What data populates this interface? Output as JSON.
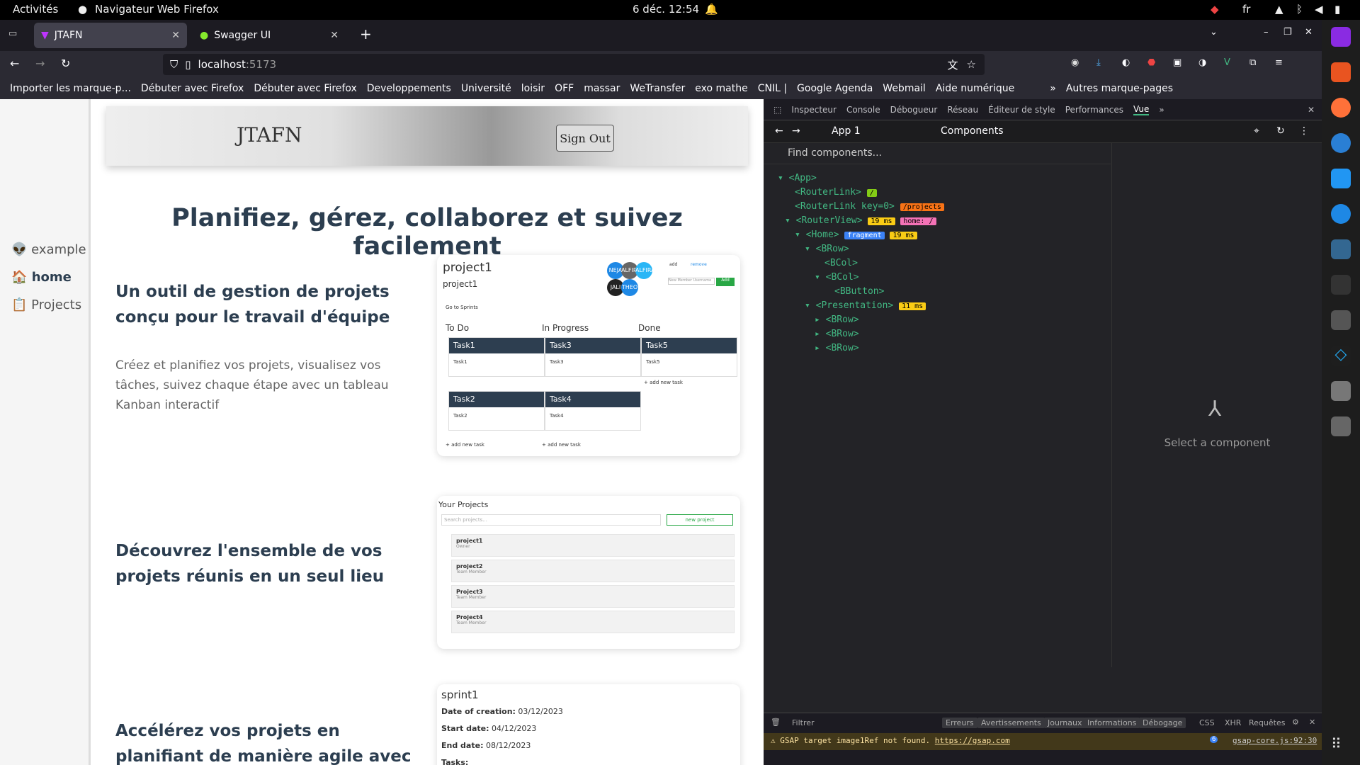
{
  "system": {
    "activities": "Activités",
    "app": "Navigateur Web Firefox",
    "clock": "6 déc. 12:54",
    "lang": "fr"
  },
  "tabs": [
    {
      "title": "JTAFN"
    },
    {
      "title": "Swagger UI"
    }
  ],
  "url": {
    "host": "localhost",
    "port": ":5173"
  },
  "bookmarks": [
    "Importer les marque-p...",
    "Débuter avec Firefox",
    "Débuter avec Firefox",
    "Developpements",
    "Université",
    "loisir",
    "OFF",
    "massar",
    "WeTransfer",
    "exo mathe",
    "CNIL |",
    "Google Agenda",
    "Webmail",
    "Aide numérique"
  ],
  "bookmarks_other": "Autres marque-pages",
  "app": {
    "brand": "JTAFN",
    "signout": "Sign Out",
    "sidebar": [
      {
        "icon": "alien-icon",
        "label": "example"
      },
      {
        "icon": "house-icon",
        "label": "home"
      },
      {
        "icon": "clipboard-icon",
        "label": "Projects"
      }
    ],
    "hero": "Planifiez, gérez, collaborez et suivez facilement",
    "features": [
      {
        "title": "Un outil de gestion de projets conçu pour le travail d'équipe",
        "text": "Créez et planifiez vos projets, visualisez vos tâches, suivez chaque étape avec un tableau Kanban interactif"
      },
      {
        "title": "Découvrez l'ensemble de vos projets réunis en un seul lieu"
      },
      {
        "title": "Accélérez vos projets en planifiant de manière agile avec des sprints, tout"
      }
    ],
    "kanban": {
      "project": "project1",
      "sub": "project1",
      "goto": "Go to Sprints",
      "add": "add",
      "remove": "remove",
      "member_ph": "New Member Username",
      "add_btn": "Add",
      "avatars": [
        "NEJA",
        "ALFIRAS",
        "JALI",
        "THEO"
      ],
      "columns": [
        "To Do",
        "In Progress",
        "Done"
      ],
      "tasks": [
        [
          "Task1",
          "Task1"
        ],
        [
          "Task3",
          "Task3"
        ],
        [
          "Task5",
          "Task5"
        ],
        [
          "Task2",
          "Task2"
        ],
        [
          "Task4",
          "Task4"
        ]
      ],
      "add_task": "+ add new task"
    },
    "projects_card": {
      "title": "Your Projects",
      "search_ph": "Search projects...",
      "new_btn": "new project",
      "items": [
        {
          "name": "project1",
          "role": "Owner"
        },
        {
          "name": "project2",
          "role": "Team Member"
        },
        {
          "name": "Project3",
          "role": "Team Member"
        },
        {
          "name": "Project4",
          "role": "Team Member"
        }
      ]
    },
    "sprint_card": {
      "title": "sprint1",
      "created_label": "Date of creation:",
      "created": "03/12/2023",
      "start_label": "Start date:",
      "start": "04/12/2023",
      "end_label": "End date:",
      "end": "08/12/2023",
      "tasks_label": "Tasks:"
    }
  },
  "devtools": {
    "tabs": [
      "Inspecteur",
      "Console",
      "Débogueur",
      "Réseau",
      "Éditeur de style",
      "Performances",
      "Vue"
    ],
    "app": "App 1",
    "components": "Components",
    "find_ph": "Find components...",
    "select": "Select a component",
    "tree": [
      "<App>",
      "<RouterLink>",
      "<RouterLink key=0>",
      "<RouterView>",
      "<Home>",
      "<BRow>",
      "<BCol>",
      "<BCol>",
      "<BButton>",
      "<Presentation>",
      "<BRow>",
      "<BRow>",
      "<BRow>"
    ],
    "badges": {
      "slash": "/",
      "projects": "/projects",
      "ms19": "19 ms",
      "home": "home: /",
      "fragment": "fragment",
      "ms19b": "19 ms",
      "ms11": "11 ms"
    },
    "console_filter": "Filtrer",
    "console_btns": [
      "Erreurs",
      "Avertissements",
      "Journaux",
      "Informations",
      "Débogage",
      "CSS",
      "XHR",
      "Requêtes"
    ],
    "warn": "GSAP target image1Ref not found.",
    "warn_link": "https://gsap.com",
    "warn_count": "6",
    "warn_src": "gsap-core.js:92:30"
  }
}
